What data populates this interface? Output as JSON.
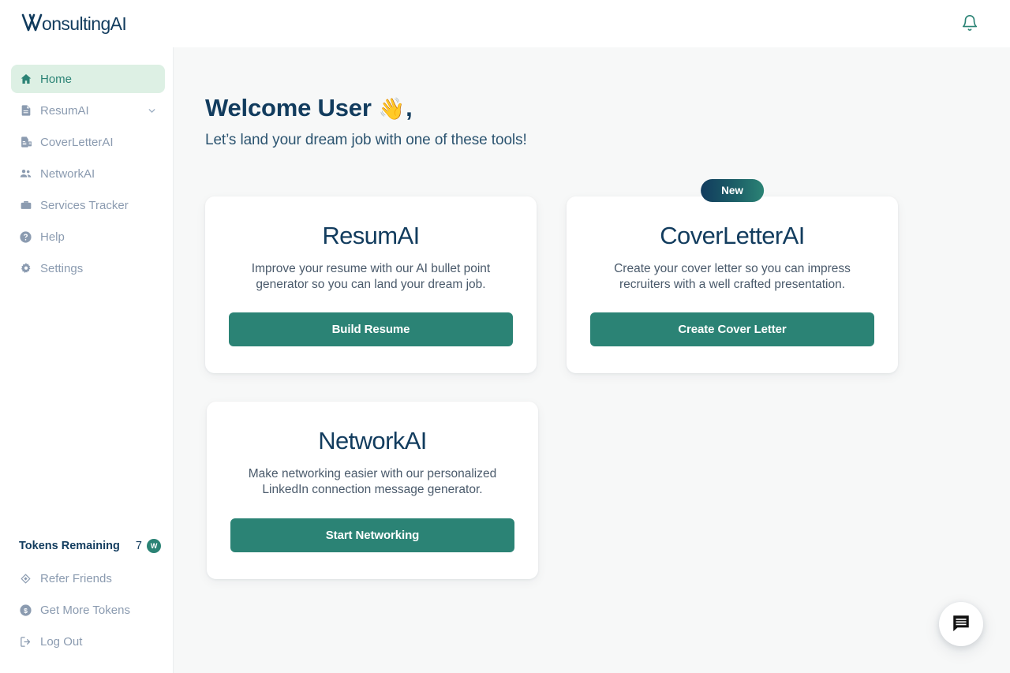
{
  "header": {
    "logo_text": "WonsultingAI",
    "notification_icon": "bell-icon"
  },
  "sidebar": {
    "items": [
      {
        "label": "Home",
        "icon": "home-icon",
        "active": true,
        "expandable": false
      },
      {
        "label": "ResumAI",
        "icon": "document-icon",
        "active": false,
        "expandable": true
      },
      {
        "label": "CoverLetterAI",
        "icon": "cover-letter-icon",
        "active": false,
        "expandable": false
      },
      {
        "label": "NetworkAI",
        "icon": "people-icon",
        "active": false,
        "expandable": false
      },
      {
        "label": "Services Tracker",
        "icon": "briefcase-icon",
        "active": false,
        "expandable": false
      },
      {
        "label": "Help",
        "icon": "question-circle-icon",
        "active": false,
        "expandable": false
      },
      {
        "label": "Settings",
        "icon": "gear-icon",
        "active": false,
        "expandable": false
      }
    ],
    "footer": {
      "tokens_label": "Tokens Remaining",
      "tokens_count": "7",
      "token_badge_text": "W",
      "items": [
        {
          "label": "Refer Friends",
          "icon": "share-icon"
        },
        {
          "label": "Get More Tokens",
          "icon": "dollar-circle-icon"
        },
        {
          "label": "Log Out",
          "icon": "logout-icon"
        }
      ]
    }
  },
  "main": {
    "welcome_title": "Welcome User",
    "welcome_emoji": "👋",
    "welcome_comma": ",",
    "welcome_subtitle": "Let’s land your dream job with one of these tools!",
    "cards": [
      {
        "title": "ResumAI",
        "description": "Improve your resume with our AI bullet point generator so you can land your dream job.",
        "button": "Build Resume",
        "badge": ""
      },
      {
        "title": "CoverLetterAI",
        "description": "Create your cover letter so you can impress recruiters with a well crafted presentation.",
        "button": "Create Cover Letter",
        "badge": "New"
      },
      {
        "title": "NetworkAI",
        "description": "Make networking easier with our personalized LinkedIn connection message generator.",
        "button": "Start Networking",
        "badge": ""
      }
    ]
  },
  "chat_widget": {
    "icon": "chat-bubble-icon"
  },
  "colors": {
    "accent_teal": "#2b8375",
    "navy": "#123c5e",
    "active_nav_bg": "#ddf0e4",
    "page_bg": "#f7f8f8",
    "muted_text": "#8b9bb0"
  }
}
